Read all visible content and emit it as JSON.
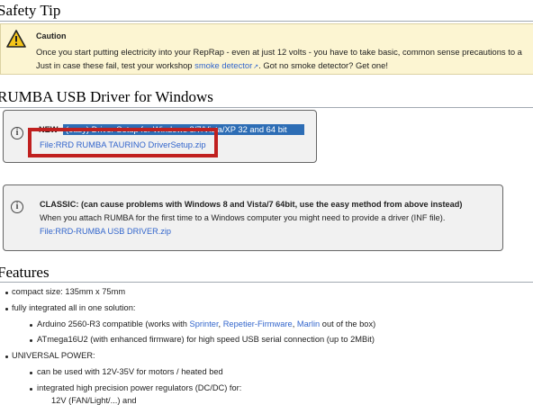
{
  "safety": {
    "heading": "Safety Tip",
    "caution_title": "Caution",
    "line1": "Once you start putting electricity into your RepRap - even at just 12 volts - you have to take basic, common sense precautions to a",
    "line2_pre": "Just in case these fail, test your workshop",
    "line2_link": "smoke detector",
    "line2_post": ". Got no smoke detector? Get one!"
  },
  "driver": {
    "heading": "RUMBA USB Driver for Windows",
    "new_prefix": "NEW",
    "new_highlight": "(easy) Driver Setup for Windows 8/7/Vista/XP 32 and 64 bit",
    "new_link": "File:RRD RUMBA TAURINO DriverSetup.zip",
    "classic_title": "CLASSIC: (can cause problems with Windows 8 and Vista/7 64bit, use the easy method from above instead)",
    "classic_body": "When you attach RUMBA for the first time to a Windows computer you might need to provide a driver (INF file).",
    "classic_link": "File:RRD-RUMBA USB DRIVER.zip"
  },
  "features": {
    "heading": "Features",
    "item1": "compact size: 135mm x 75mm",
    "item2": "fully integrated all in one solution:",
    "sub1_pre": "Arduino 2560-R3 compatible (works with",
    "sub1_link1": "Sprinter",
    "sub1_link2": "Repetier-Firmware",
    "sub1_link3": "Marlin",
    "sub1_post": "out of the box)",
    "sub2": "ATmega16U2 (with enhanced firmware) for high speed USB serial connection (up to 2MBit)",
    "item3": "UNIVERSAL POWER:",
    "sub3": "can be used with 12V-35V for motors / heated bed",
    "sub4": "integrated high precision power regulators (DC/DC) for:",
    "sub5": "12V (FAN/Light/...) and"
  }
}
